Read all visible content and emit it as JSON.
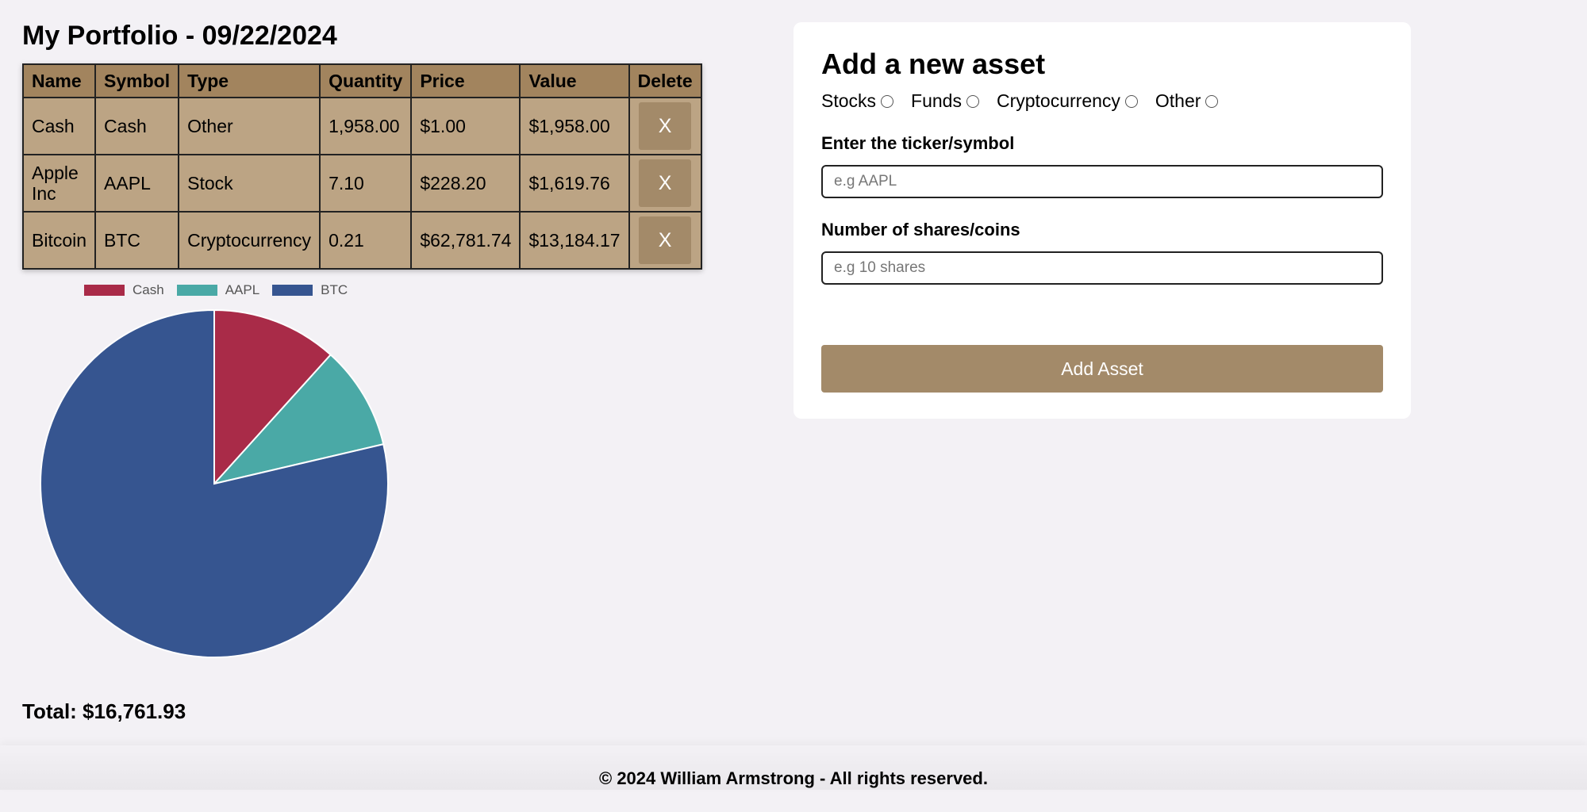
{
  "page": {
    "title": "My Portfolio - 09/22/2024",
    "total_label": "Total: $16,761.93"
  },
  "table": {
    "headers": [
      "Name",
      "Symbol",
      "Type",
      "Quantity",
      "Price",
      "Value",
      "Delete"
    ],
    "rows": [
      {
        "name": "Cash",
        "symbol": "Cash",
        "type": "Other",
        "quantity": "1,958.00",
        "price": "$1.00",
        "value": "$1,958.00",
        "delete": "X"
      },
      {
        "name": "Apple Inc",
        "symbol": "AAPL",
        "type": "Stock",
        "quantity": "7.10",
        "price": "$228.20",
        "value": "$1,619.76",
        "delete": "X"
      },
      {
        "name": "Bitcoin",
        "symbol": "BTC",
        "type": "Cryptocurrency",
        "quantity": "0.21",
        "price": "$62,781.74",
        "value": "$13,184.17",
        "delete": "X"
      }
    ]
  },
  "chart_data": {
    "type": "pie",
    "categories": [
      "Cash",
      "AAPL",
      "BTC"
    ],
    "values": [
      1958.0,
      1619.76,
      13184.17
    ],
    "colors": [
      "#a92b48",
      "#4aa9a6",
      "#365590"
    ],
    "legend": "top"
  },
  "form": {
    "title": "Add a new asset",
    "asset_types": [
      "Stocks",
      "Funds",
      "Cryptocurrency",
      "Other"
    ],
    "ticker_label": "Enter the ticker/symbol",
    "ticker_placeholder": "e.g AAPL",
    "ticker_value": "",
    "shares_label": "Number of shares/coins",
    "shares_placeholder": "e.g 10 shares",
    "shares_value": "",
    "submit_label": "Add Asset"
  },
  "footer": {
    "text": "© 2024 William Armstrong - All rights reserved."
  },
  "colors": {
    "background": "#f3f1f5",
    "table_header": "#a2845e",
    "table_body": "#bca484",
    "accent_button": "#a38a69"
  }
}
